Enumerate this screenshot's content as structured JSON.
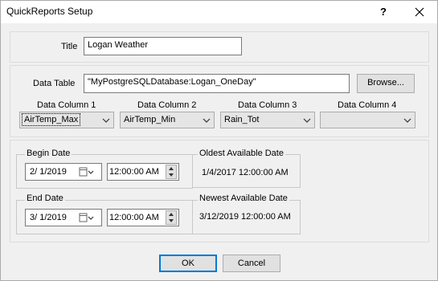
{
  "window": {
    "title": "QuickReports Setup",
    "help_label": "?"
  },
  "title_field": {
    "label": "Title",
    "value": "Logan Weather"
  },
  "data_table": {
    "label": "Data Table",
    "value": "\"MyPostgreSQLDatabase:Logan_OneDay\"",
    "browse_label": "Browse..."
  },
  "columns": [
    {
      "label": "Data Column 1",
      "value": "AirTemp_Max"
    },
    {
      "label": "Data Column 2",
      "value": "AirTemp_Min"
    },
    {
      "label": "Data Column 3",
      "value": "Rain_Tot"
    },
    {
      "label": "Data Column 4",
      "value": ""
    }
  ],
  "begin": {
    "label": "Begin Date",
    "date": "2/  1/2019",
    "time": "12:00:00 AM"
  },
  "end": {
    "label": "End Date",
    "date": "3/  1/2019",
    "time": "12:00:00 AM"
  },
  "oldest": {
    "label": "Oldest Available Date",
    "value": "1/4/2017 12:00:00 AM"
  },
  "newest": {
    "label": "Newest Available Date",
    "value": "3/12/2019 12:00:00 AM"
  },
  "buttons": {
    "ok": "OK",
    "cancel": "Cancel"
  },
  "colors": {
    "face": "#f0f0f0",
    "accent": "#0078d7"
  }
}
